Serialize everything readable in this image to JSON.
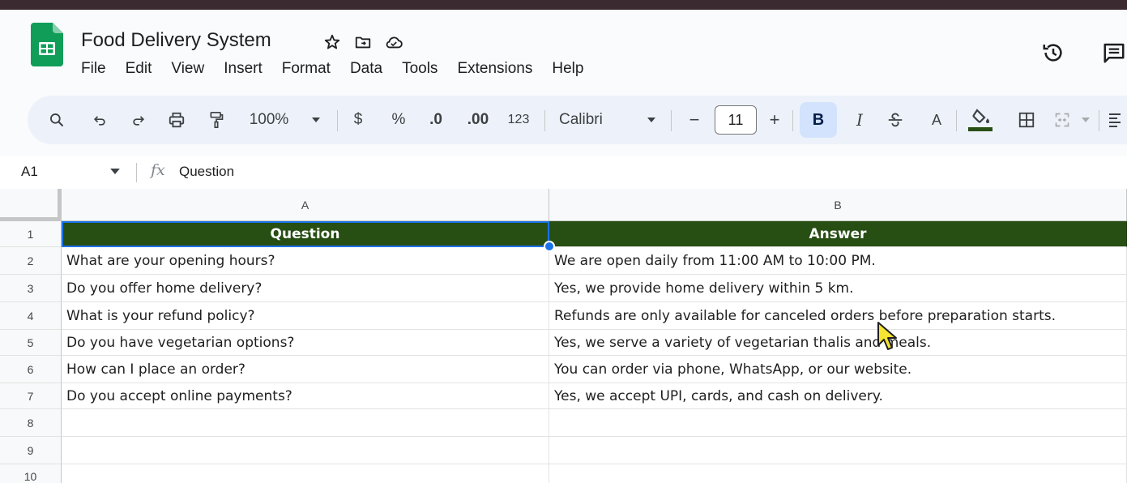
{
  "doc": {
    "title": "Food Delivery System",
    "brand_color": "#0f9d58"
  },
  "menu": [
    "File",
    "Edit",
    "View",
    "Insert",
    "Format",
    "Data",
    "Tools",
    "Extensions",
    "Help"
  ],
  "toolbar": {
    "zoom": "100%",
    "currency": "$",
    "percent": "%",
    "decrease_decimal": ".0",
    "increase_decimal": ".00",
    "number_format": "123",
    "font": "Calibri",
    "font_size": "11",
    "minus": "−",
    "plus": "+",
    "bold": "B",
    "italic": "I",
    "text_color": "A",
    "fill_color_swatch": "#274e13"
  },
  "formula_bar": {
    "cell_ref": "A1",
    "fx": "fx",
    "content": "Question"
  },
  "sheet": {
    "columns": [
      "A",
      "B"
    ],
    "row_numbers": [
      "1",
      "2",
      "3",
      "4",
      "5",
      "6",
      "7",
      "8",
      "9",
      "10"
    ],
    "header_fill": "#274e13",
    "rows": [
      [
        "Question",
        "Answer"
      ],
      [
        "What are your opening hours?",
        "We are open daily from 11:00 AM to 10:00 PM."
      ],
      [
        "Do you offer home delivery?",
        "Yes, we provide home delivery within 5 km."
      ],
      [
        "What is your refund policy?",
        "Refunds are only available for canceled orders before preparation starts."
      ],
      [
        "Do you have vegetarian options?",
        "Yes, we serve a variety of vegetarian thalis and meals."
      ],
      [
        "How can I place an order?",
        "You can order via phone, WhatsApp, or our website."
      ],
      [
        "Do you accept online payments?",
        "Yes, we accept UPI, cards, and cash on delivery."
      ],
      [
        "",
        ""
      ],
      [
        "",
        ""
      ],
      [
        "",
        ""
      ]
    ]
  }
}
